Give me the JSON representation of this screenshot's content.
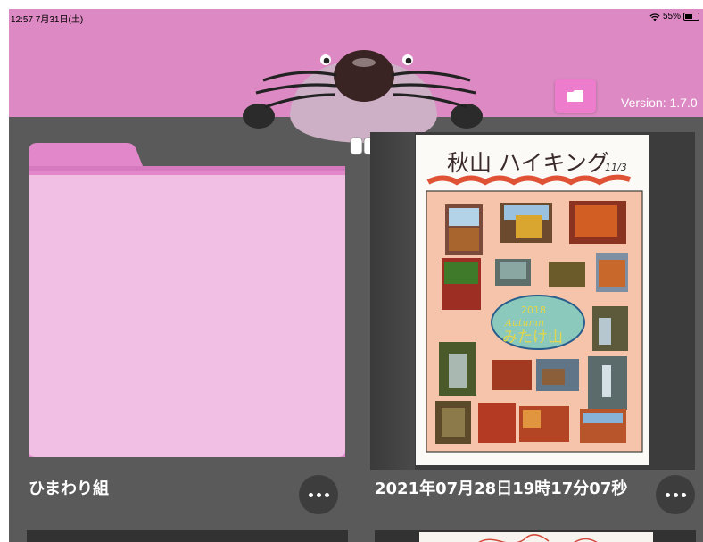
{
  "status_bar": {
    "time": "12:57 7月31日(土)",
    "battery": "55%"
  },
  "header": {
    "version": "Version: 1.7.0"
  },
  "cards": [
    {
      "title": "ひまわり組"
    },
    {
      "title": "2021年07月28日19時17分07秒"
    }
  ],
  "drawing": {
    "heading": "秋山 ハイキング",
    "date": "11/3",
    "year": "2018",
    "script_word": "Autumn",
    "place": "みたけ山"
  },
  "colors": {
    "header_bg": "#dd8ac4",
    "folder_body": "#f0bfe3",
    "folder_tab": "#e287c9",
    "app_bg": "#5a5a5a",
    "button_bg": "#3d3d3d"
  }
}
